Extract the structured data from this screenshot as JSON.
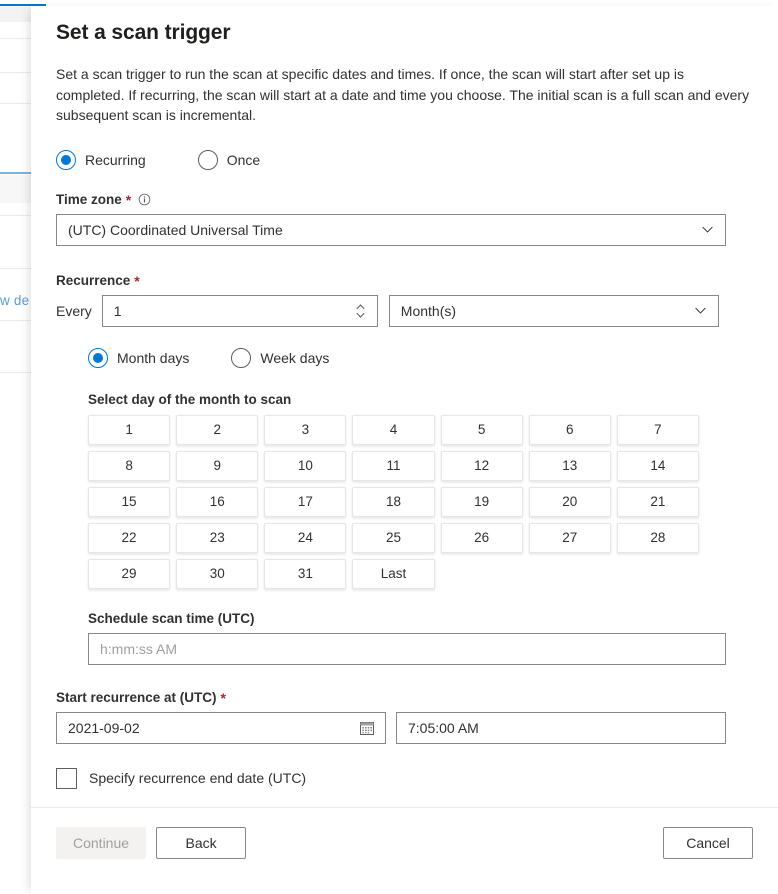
{
  "background": {
    "truncated_link": "w de"
  },
  "panel": {
    "title": "Set a scan trigger",
    "description": "Set a scan trigger to run the scan at specific dates and times. If once, the scan will start after set up is completed. If recurring, the scan will start at a date and time you choose. The initial scan is a full scan and every subsequent scan is incremental."
  },
  "trigger_type": {
    "options": [
      {
        "label": "Recurring",
        "checked": true
      },
      {
        "label": "Once",
        "checked": false
      }
    ]
  },
  "timezone": {
    "label": "Time zone",
    "required": "*",
    "info_icon": "info-icon",
    "value": "(UTC) Coordinated Universal Time",
    "chevron": "chevron-down-icon"
  },
  "recurrence": {
    "label": "Recurrence",
    "required": "*",
    "every_text": "Every",
    "interval_value": "1",
    "unit_value": "Month(s)",
    "spinner": "spinner-updown-icon",
    "chevron": "chevron-down-icon"
  },
  "day_mode": {
    "options": [
      {
        "label": "Month days",
        "checked": true
      },
      {
        "label": "Week days",
        "checked": false
      }
    ]
  },
  "day_grid": {
    "label": "Select day of the month to scan",
    "days": [
      "1",
      "2",
      "3",
      "4",
      "5",
      "6",
      "7",
      "8",
      "9",
      "10",
      "11",
      "12",
      "13",
      "14",
      "15",
      "16",
      "17",
      "18",
      "19",
      "20",
      "21",
      "22",
      "23",
      "24",
      "25",
      "26",
      "27",
      "28",
      "29",
      "30",
      "31",
      "Last"
    ]
  },
  "schedule_time": {
    "label": "Schedule scan time (UTC)",
    "value": "",
    "placeholder": "h:mm:ss AM"
  },
  "start_recurrence": {
    "label": "Start recurrence at (UTC)",
    "required": "*",
    "date_value": "2021-09-02",
    "date_icon": "calendar-icon",
    "time_value": "7:05:00 AM"
  },
  "end_date_checkbox": {
    "label": "Specify recurrence end date (UTC)",
    "checked": false
  },
  "footer": {
    "continue_label": "Continue",
    "back_label": "Back",
    "cancel_label": "Cancel"
  },
  "colors": {
    "accent": "#0078d4",
    "required": "#a4262c",
    "link": "#5b9bd5",
    "text": "#323130"
  }
}
